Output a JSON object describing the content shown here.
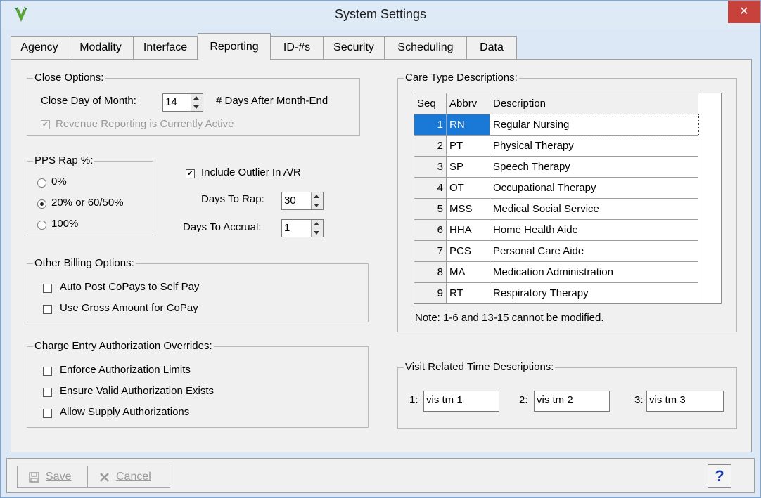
{
  "window": {
    "title": "System Settings",
    "close_label": "✕"
  },
  "tabs": [
    "Agency",
    "Modality",
    "Interface",
    "Reporting",
    "ID-#s",
    "Security",
    "Scheduling",
    "Data"
  ],
  "close_options": {
    "title": "Close Options:",
    "close_day_label": "Close Day of Month:",
    "close_day_value": "14",
    "days_after_label": "# Days After Month-End",
    "revenue_label": "Revenue Reporting is Currently Active",
    "revenue_checked": true
  },
  "pps": {
    "title": "PPS Rap %:",
    "options": [
      "0%",
      "20% or 60/50%",
      "100%"
    ],
    "selected": "20% or 60/50%"
  },
  "outlier": {
    "label": "Include Outlier In A/R",
    "checked": true
  },
  "days_to_rap": {
    "label": "Days To Rap:",
    "value": "30"
  },
  "days_to_accrual": {
    "label": "Days To Accrual:",
    "value": "1"
  },
  "other_billing": {
    "title": "Other Billing Options:",
    "items": [
      "Auto Post CoPays to Self Pay",
      "Use Gross Amount for CoPay"
    ]
  },
  "charge_entry": {
    "title": "Charge Entry Authorization Overrides:",
    "items": [
      "Enforce Authorization Limits",
      "Ensure Valid Authorization Exists",
      "Allow Supply Authorizations"
    ]
  },
  "care_types": {
    "title": "Care Type Descriptions:",
    "headers": [
      "Seq",
      "Abbrv",
      "Description"
    ],
    "rows": [
      [
        "1",
        "RN",
        "Regular Nursing"
      ],
      [
        "2",
        "PT",
        "Physical Therapy"
      ],
      [
        "3",
        "SP",
        "Speech Therapy"
      ],
      [
        "4",
        "OT",
        "Occupational Therapy"
      ],
      [
        "5",
        "MSS",
        "Medical Social Service"
      ],
      [
        "6",
        "HHA",
        "Home Health Aide"
      ],
      [
        "7",
        "PCS",
        "Personal Care Aide"
      ],
      [
        "8",
        "MA",
        "Medication Administration"
      ],
      [
        "9",
        "RT",
        "Respiratory Therapy"
      ]
    ],
    "note": "Note: 1-6 and 13-15 cannot be modified."
  },
  "visit_time": {
    "title": "Visit Related Time Descriptions:",
    "fields": [
      {
        "label": "1:",
        "value": "vis tm 1"
      },
      {
        "label": "2:",
        "value": "vis tm 2"
      },
      {
        "label": "3:",
        "value": "vis tm 3"
      }
    ]
  },
  "buttons": {
    "save": "Save",
    "cancel": "Cancel",
    "help": "?"
  }
}
